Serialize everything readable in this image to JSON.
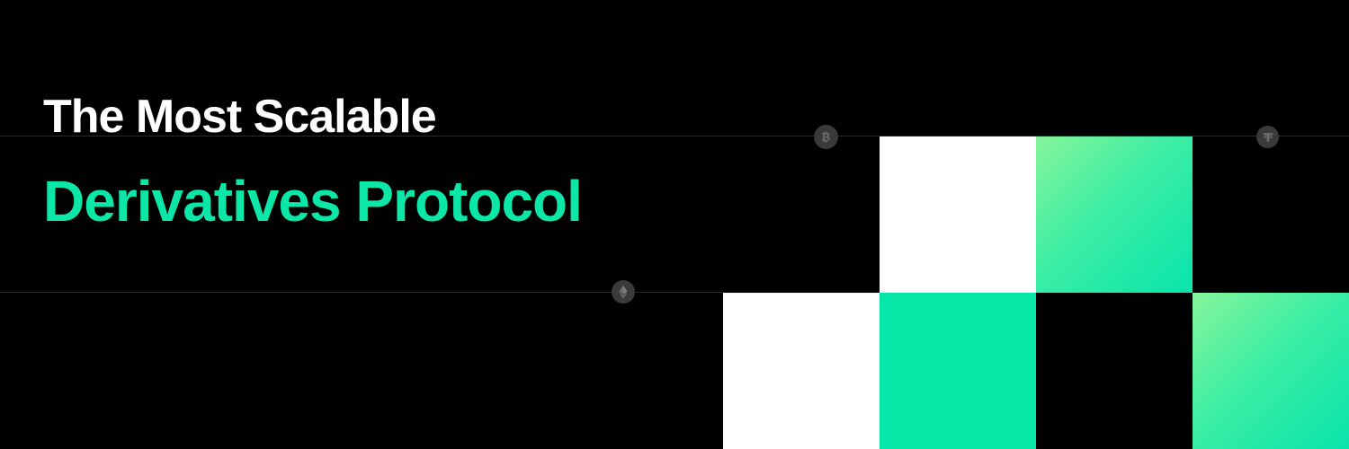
{
  "headline": {
    "line1": "The Most Scalable",
    "line2": "Derivatives Protocol"
  },
  "colors": {
    "background": "#000000",
    "line1_text": "#ffffff",
    "accent_green": "#05e6a7",
    "gradient_start": "#86f59b",
    "gradient_end": "#09e4ab",
    "coin_badge": "#3a3a3a",
    "divider_line": "#2b2b2b"
  },
  "icons": [
    "bitcoin-icon",
    "tether-icon",
    "ethereum-icon"
  ],
  "tiles": [
    "white",
    "gradient",
    "white",
    "green",
    "gradient"
  ]
}
